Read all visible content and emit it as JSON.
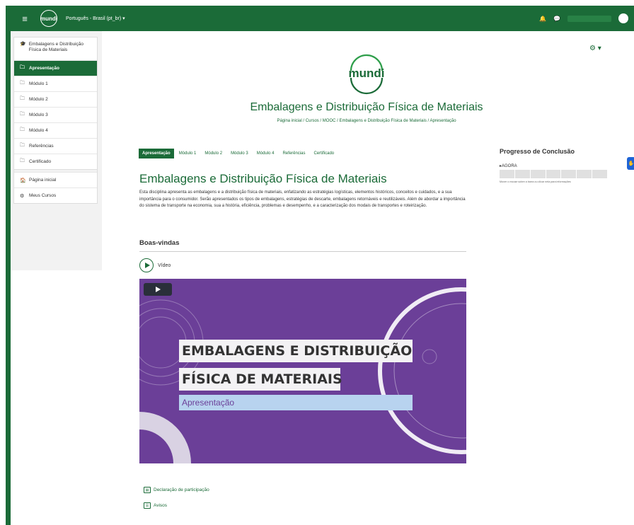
{
  "navbar": {
    "menu_icon": "hamburger-icon",
    "logo_text": "mundi",
    "language": "Português - Brasil (pt_br) ▾",
    "bell_icon": "bell-icon",
    "chat_icon": "chat-icon"
  },
  "drawer": {
    "course": "Embalagens e Distribuição Física de Materiais",
    "items": [
      {
        "label": "Apresentação",
        "icon": "folder-icon"
      },
      {
        "label": "Módulo 1",
        "icon": "folder-icon"
      },
      {
        "label": "Módulo 2",
        "icon": "folder-icon"
      },
      {
        "label": "Módulo 3",
        "icon": "folder-icon"
      },
      {
        "label": "Módulo 4",
        "icon": "folder-icon"
      },
      {
        "label": "Referências",
        "icon": "folder-icon"
      },
      {
        "label": "Certificado",
        "icon": "folder-icon"
      }
    ],
    "home": "Página inicial",
    "my_courses": "Meus Cursos"
  },
  "header": {
    "logo_text": "mundi",
    "title": "Embalagens e Distribuição Física de Materiais",
    "breadcrumb": "Página inicial / Cursos / MOOC / Embalagens e Distribuição Física de Materiais / Apresentação"
  },
  "tabs": [
    "Apresentação",
    "Módulo 1",
    "Módulo 2",
    "Módulo 3",
    "Módulo 4",
    "Referências",
    "Certificado"
  ],
  "section": {
    "title": "Embalagens e Distribuição Física de Materiais",
    "description": "Esta disciplina apresenta as embalagens e a distribuição física de materiais, enfatizando as estratégias logísticas, elementos históricos, conceitos e cuidados, e a sua importância para o consumidor. Serão apresentados os tipos de embalagens, estratégias de descarte, embalagens retornáveis e reutilizáveis. Além de abordar a importância do sistema de transporte na economia, sua a história, eficiência, problemas e desempenho, e a caracterização dos modais de transportes e roteirização.",
    "welcome": "Boas-vindas",
    "video_label": "Vídeo",
    "video_line1": "EMBALAGENS E DISTRIBUIÇÃO",
    "video_line2": "FÍSICA DE MATERIAIS",
    "video_sub": "Apresentação"
  },
  "progress": {
    "title": "Progresso de Conclusão",
    "now": "AGORA",
    "hint": "Mover o mouse sobre a barra ou clicar nela para informações"
  },
  "links": {
    "declaration": "Declaração de participação",
    "notices": "Avisos"
  }
}
